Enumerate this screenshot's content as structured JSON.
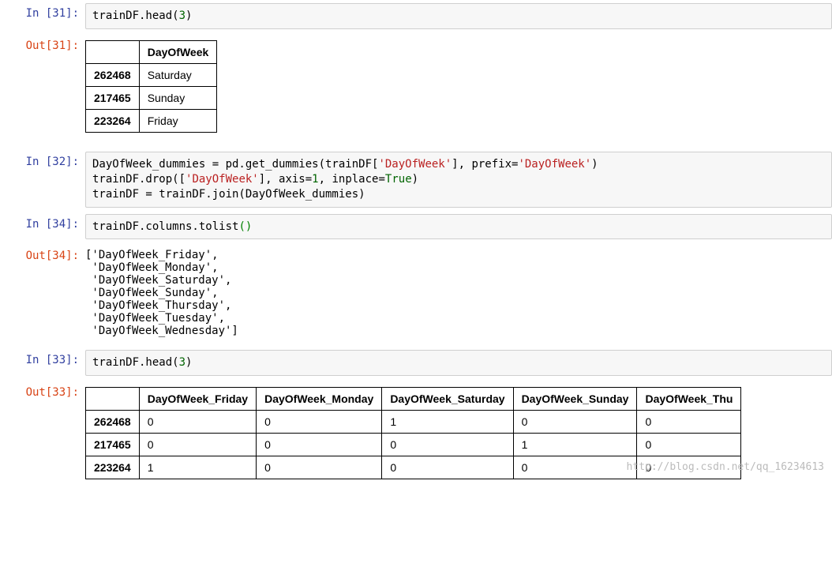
{
  "cells": [
    {
      "in_label": "In [31]:",
      "code": "trainDF.head(3)",
      "code_tokens": [
        {
          "text": "trainDF.head("
        },
        {
          "text": "3",
          "class": "num"
        },
        {
          "text": ")"
        }
      ],
      "out_label": "Out[31]:",
      "table": {
        "columns": [
          "",
          "DayOfWeek"
        ],
        "rows": [
          {
            "index": "262468",
            "values": [
              "Saturday"
            ]
          },
          {
            "index": "217465",
            "values": [
              "Sunday"
            ]
          },
          {
            "index": "223264",
            "values": [
              "Friday"
            ]
          }
        ]
      }
    },
    {
      "in_label": "In [32]:",
      "code_tokens": [
        {
          "text": "DayOfWeek_dummies = pd.get_dummies(trainDF["
        },
        {
          "text": "'DayOfWeek'",
          "class": "str"
        },
        {
          "text": "], prefix="
        },
        {
          "text": "'DayOfWeek'",
          "class": "str"
        },
        {
          "text": ")\ntrainDF.drop(["
        },
        {
          "text": "'DayOfWeek'",
          "class": "str"
        },
        {
          "text": "], axis="
        },
        {
          "text": "1",
          "class": "num"
        },
        {
          "text": ", inplace="
        },
        {
          "text": "True",
          "class": "kw"
        },
        {
          "text": ")\ntrainDF = trainDF.join(DayOfWeek_dummies)"
        }
      ]
    },
    {
      "in_label": "In [34]:",
      "code_tokens": [
        {
          "text": "trainDF.columns.tolist"
        },
        {
          "text": "()",
          "class": "paren-g"
        }
      ],
      "out_label": "Out[34]:",
      "text_output": "['DayOfWeek_Friday',\n 'DayOfWeek_Monday',\n 'DayOfWeek_Saturday',\n 'DayOfWeek_Sunday',\n 'DayOfWeek_Thursday',\n 'DayOfWeek_Tuesday',\n 'DayOfWeek_Wednesday']"
    },
    {
      "in_label": "In [33]:",
      "code_tokens": [
        {
          "text": "trainDF.head("
        },
        {
          "text": "3",
          "class": "num"
        },
        {
          "text": ")"
        }
      ],
      "out_label": "Out[33]:",
      "table": {
        "columns": [
          "",
          "DayOfWeek_Friday",
          "DayOfWeek_Monday",
          "DayOfWeek_Saturday",
          "DayOfWeek_Sunday",
          "DayOfWeek_Thu"
        ],
        "rows": [
          {
            "index": "262468",
            "values": [
              "0",
              "0",
              "1",
              "0",
              "0"
            ]
          },
          {
            "index": "217465",
            "values": [
              "0",
              "0",
              "0",
              "1",
              "0"
            ]
          },
          {
            "index": "223264",
            "values": [
              "1",
              "0",
              "0",
              "0",
              "0"
            ]
          }
        ]
      }
    }
  ],
  "watermark": "http://blog.csdn.net/qq_16234613"
}
